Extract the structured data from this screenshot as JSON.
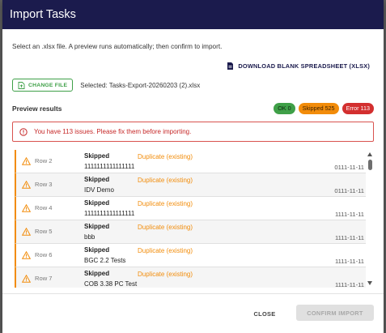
{
  "dialog": {
    "title": "Import Tasks",
    "intro": "Select an .xlsx file. A preview runs automatically; then confirm to import.",
    "download_label": "DOWNLOAD BLANK SPREADSHEET (XLSX)",
    "change_label": "CHANGE FILE",
    "selected_file": "Selected: Tasks-Export-20260203 (2).xlsx"
  },
  "preview": {
    "title": "Preview results",
    "badges": {
      "ok": "OK 0",
      "skipped": "Skipped 525",
      "error": "Error 113"
    }
  },
  "alert": {
    "text": "You have 113 issues. Please fix them before importing."
  },
  "rows": [
    {
      "label": "Row 2",
      "status": "Skipped",
      "name": "1111111111111111",
      "reason": "Duplicate (existing)",
      "date": "0111-11-11"
    },
    {
      "label": "Row 3",
      "status": "Skipped",
      "name": "IDV Demo",
      "reason": "Duplicate (existing)",
      "date": "0111-11-11"
    },
    {
      "label": "Row 4",
      "status": "Skipped",
      "name": "1111111111111111",
      "reason": "Duplicate (existing)",
      "date": "1111-11-11"
    },
    {
      "label": "Row 5",
      "status": "Skipped",
      "name": "bbb",
      "reason": "Duplicate (existing)",
      "date": "1111-11-11"
    },
    {
      "label": "Row 6",
      "status": "Skipped",
      "name": "BGC 2.2 Tests",
      "reason": "Duplicate (existing)",
      "date": "1111-11-11"
    },
    {
      "label": "Row 7",
      "status": "Skipped",
      "name": "COB 3.38 PC Test",
      "reason": "Duplicate (existing)",
      "date": "1111-11-11"
    }
  ],
  "footer": {
    "close_label": "CLOSE",
    "confirm_label": "CONFIRM IMPORT"
  },
  "colors": {
    "header": "#1b1b4d",
    "ok": "#3fa048",
    "skipped": "#f28c0a",
    "error": "#d32f2f"
  }
}
